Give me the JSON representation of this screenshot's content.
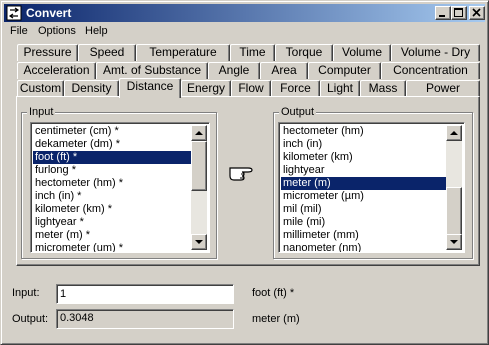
{
  "window": {
    "title": "Convert",
    "icon": "convert-app-icon"
  },
  "menu": [
    "File",
    "Options",
    "Help"
  ],
  "tabs": {
    "row1": [
      "Pressure",
      "Speed",
      "Temperature",
      "Time",
      "Torque",
      "Volume",
      "Volume - Dry"
    ],
    "row2": [
      "Acceleration",
      "Amt. of Substance",
      "Angle",
      "Area",
      "Computer",
      "Concentration"
    ],
    "row3": [
      "Custom",
      "Density",
      "Distance",
      "Energy",
      "Flow",
      "Force",
      "Light",
      "Mass",
      "Power"
    ],
    "active": "Distance"
  },
  "input_group": {
    "label": "Input",
    "items": [
      "centimeter (cm) *",
      "dekameter (dm) *",
      "foot (ft) *",
      "furlong *",
      "hectometer (hm) *",
      "inch (in) *",
      "kilometer (km) *",
      "lightyear *",
      "meter (m) *",
      "micrometer (um) *"
    ],
    "selected": "foot (ft) *"
  },
  "output_group": {
    "label": "Output",
    "items": [
      "hectometer (hm)",
      "inch (in)",
      "kilometer (km)",
      "lightyear",
      "meter (m)",
      "micrometer (µm)",
      "mil (mil)",
      "mile (mi)",
      "millimeter (mm)",
      "nanometer (nm)"
    ],
    "selected": "meter (m)"
  },
  "convert_indicator": {
    "icon": "pointing-hand-icon"
  },
  "input": {
    "label": "Input:",
    "value": "1",
    "unit": "foot (ft) *"
  },
  "output": {
    "label": "Output:",
    "value": "0.3048",
    "unit": "meter (m)"
  },
  "colors": {
    "titlebar_start": "#0a246a",
    "titlebar_end": "#a6caf0",
    "selection": "#0a246a",
    "face": "#d4d0c8"
  }
}
